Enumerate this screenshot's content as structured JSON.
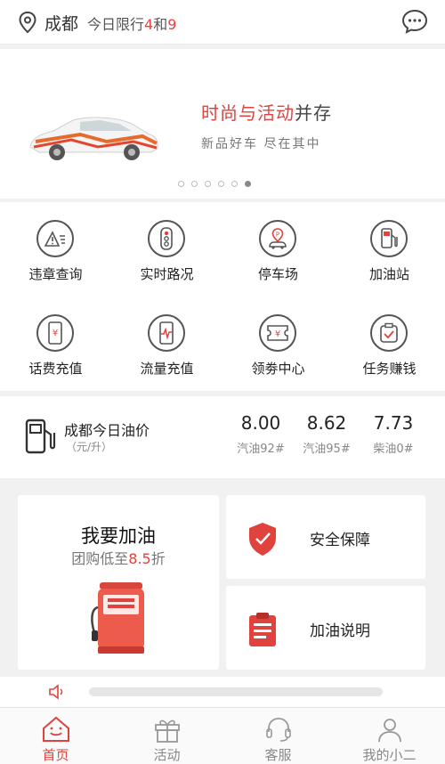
{
  "header": {
    "city": "成都",
    "limit_prefix": "今日限行",
    "limit_a": "4",
    "limit_and": "和",
    "limit_b": "9"
  },
  "banner": {
    "title_red": "时尚与活动",
    "title_dark": "并存",
    "subtitle": "新品好车 尽在其中",
    "slide_count": 6,
    "active_slide": 6
  },
  "services": [
    {
      "label": "违章查询",
      "icon": "warning-triangle-icon"
    },
    {
      "label": "实时路况",
      "icon": "traffic-light-icon"
    },
    {
      "label": "停车场",
      "icon": "parking-pin-icon"
    },
    {
      "label": "加油站",
      "icon": "gas-station-icon"
    },
    {
      "label": "话费充值",
      "icon": "phone-yen-icon"
    },
    {
      "label": "流量充值",
      "icon": "phone-pulse-icon"
    },
    {
      "label": "领劵中心",
      "icon": "coupon-yen-icon"
    },
    {
      "label": "任务赚钱",
      "icon": "task-check-icon"
    }
  ],
  "oil": {
    "title": "成都今日油价",
    "unit": "（元/升）",
    "prices": [
      {
        "value": "8.00",
        "label": "汽油92#"
      },
      {
        "value": "8.62",
        "label": "汽油95#"
      },
      {
        "value": "7.73",
        "label": "柴油0#"
      }
    ]
  },
  "refuel_card": {
    "title": "我要加油",
    "sub_prefix": "团购低至",
    "sub_value": "8.5",
    "sub_suffix": "折"
  },
  "side_cards": [
    {
      "label": "安全保障",
      "icon": "shield-icon"
    },
    {
      "label": "加油说明",
      "icon": "clipboard-icon"
    }
  ],
  "tabs": [
    {
      "label": "首页",
      "icon": "home-icon",
      "active": true
    },
    {
      "label": "活动",
      "icon": "gift-icon",
      "active": false
    },
    {
      "label": "客服",
      "icon": "headset-icon",
      "active": false
    },
    {
      "label": "我的小二",
      "icon": "user-icon",
      "active": false
    }
  ],
  "colors": {
    "accent": "#e0433d",
    "icon_stroke": "#555555"
  }
}
